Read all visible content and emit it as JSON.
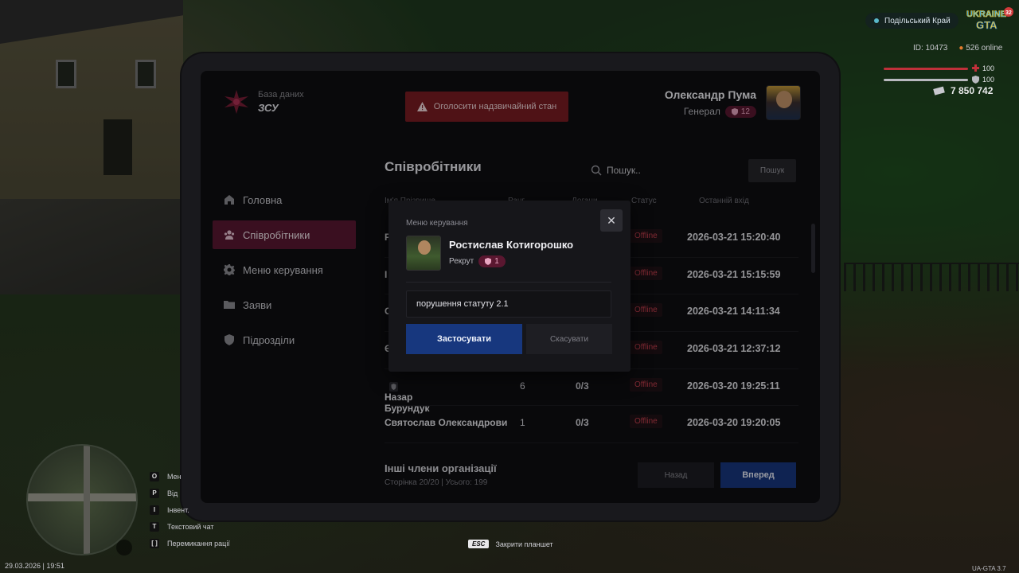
{
  "app": {
    "brand_sub": "База даних",
    "brand_name": "ЗСУ",
    "emergency_label": "Оголосити надзвичайний стан",
    "user_name": "Олександр Пума",
    "user_rank": "Генерал",
    "user_rank_level": "12",
    "accent_color": "#5a1832",
    "primary_color": "#17377e"
  },
  "sidebar": {
    "items": [
      {
        "label": "Головна",
        "icon": "home-icon"
      },
      {
        "label": "Співробітники",
        "icon": "users-icon",
        "active": true
      },
      {
        "label": "Меню керування",
        "icon": "gear-icon"
      },
      {
        "label": "Заяви",
        "icon": "folder-icon"
      },
      {
        "label": "Підрозділи",
        "icon": "shield-icon"
      }
    ]
  },
  "main": {
    "title": "Співробітники",
    "search_placeholder": "Пошук..",
    "search_button": "Пошук",
    "columns": [
      "Ім'я Прізвище",
      "Ранг",
      "Догани",
      "Статус",
      "Останній вхід"
    ],
    "rows": [
      {
        "name": "Р",
        "level": "",
        "warns": "",
        "status": "Offline",
        "last": "2026-03-21 15:20:40"
      },
      {
        "name": "І",
        "level": "",
        "warns": "",
        "status": "Offline",
        "last": "2026-03-21 15:15:59"
      },
      {
        "name": "С",
        "level": "",
        "warns": "",
        "status": "Offline",
        "last": "2026-03-21 14:11:34"
      },
      {
        "name": "Є",
        "level": "",
        "warns": "",
        "status": "Offline",
        "last": "2026-03-21 12:37:12"
      },
      {
        "name": "Назар Бурундук",
        "level": "6",
        "warns": "0/3",
        "status": "Offline",
        "last": "2026-03-20 19:25:11"
      },
      {
        "name": "Святослав Олександрови",
        "level": "1",
        "warns": "0/3",
        "status": "Offline",
        "last": "2026-03-20 19:20:05"
      }
    ],
    "footer_title": "Інші члени організації",
    "footer_sub": "Сторінка 20/20 | Усього: 199",
    "back_label": "Назад",
    "next_label": "Вперед"
  },
  "modal": {
    "title": "Меню керування",
    "name": "Ростислав Котигорошко",
    "rank": "Рекрут",
    "rank_level": "1",
    "reason_value": "порушення статуту 2.1",
    "apply_label": "Застосувати",
    "cancel_label": "Скасувати"
  },
  "hud": {
    "server": "Подільський Край",
    "logo_text": "UKRAINE GTA",
    "logo_badge": "32",
    "id_text": "ID: 10473",
    "online_text": "526 online",
    "health": "100",
    "armor": "100",
    "money": "7 850 742",
    "keys": [
      {
        "key": "O",
        "label": "Мен"
      },
      {
        "key": "P",
        "label": "Від"
      },
      {
        "key": "I",
        "label": "Інвент."
      },
      {
        "key": "T",
        "label": "Текстовий чат"
      },
      {
        "key": "[ ]",
        "label": "Перемикання рації"
      }
    ],
    "datetime": "29.03.2026 | 19:51",
    "esc_key": "ESC",
    "esc_label": "Закрити планшет",
    "version": "UA-GTA 3.7"
  }
}
